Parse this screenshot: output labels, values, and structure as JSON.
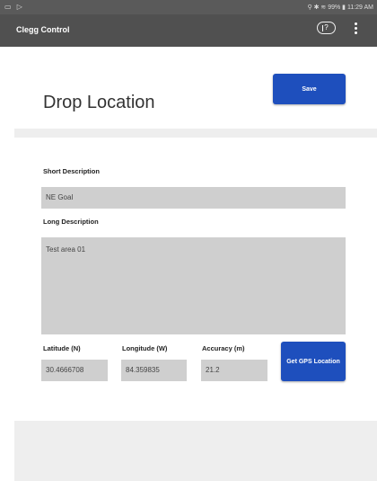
{
  "status_bar": {
    "left_icons": "▭ ▷",
    "right_text": "⚲ ✱ ≋ 99% ▮ 11:29 AM"
  },
  "app_bar": {
    "title": "Clegg Control",
    "help_icon": "help-icon",
    "menu_icon": "more-vert-icon",
    "help_label": "?"
  },
  "page": {
    "title": "Drop Location",
    "save_label": "Save"
  },
  "form": {
    "short_description": {
      "label": "Short Description",
      "value": "NE Goal"
    },
    "long_description": {
      "label": "Long Description",
      "value": "Test area 01"
    },
    "latitude": {
      "label": "Latitude (N)",
      "value": "30.4666708"
    },
    "longitude": {
      "label": "Longitude (W)",
      "value": "84.359835"
    },
    "accuracy": {
      "label": "Accuracy (m)",
      "value": "21.2"
    },
    "gps_button_label": "Get GPS Location"
  },
  "colors": {
    "accent": "#1e4fbd",
    "app_bar": "#505050",
    "field_bg": "#cfcfcf"
  }
}
